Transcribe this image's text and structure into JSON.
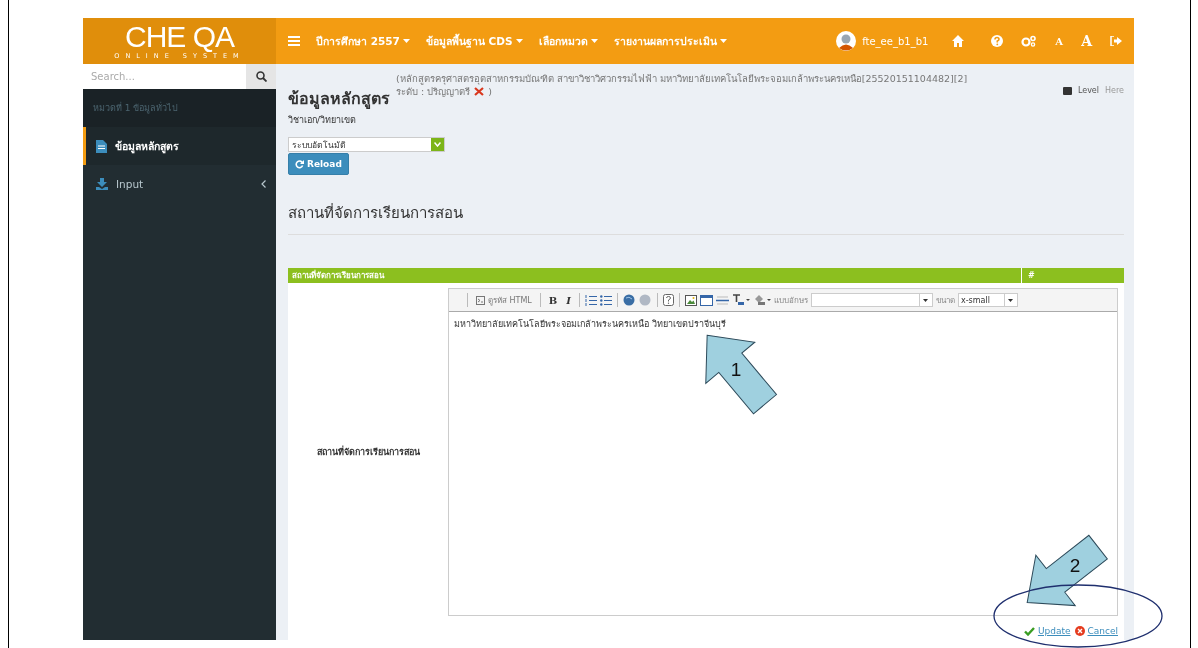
{
  "topbar": {
    "logo": {
      "title": "CHE QA",
      "subtitle": "ONLINE SYSTEM"
    },
    "nav": [
      {
        "label": "ปีการศึกษา 2557"
      },
      {
        "label": "ข้อมูลพื้นฐาน CDS"
      },
      {
        "label": "เลือกหมวด"
      },
      {
        "label": "รายงานผลการประเมิน"
      }
    ],
    "user": {
      "name": "fte_ee_b1_b1"
    },
    "font_buttons": [
      {
        "label": "A",
        "kind": "small"
      },
      {
        "label": "A",
        "kind": "large"
      }
    ]
  },
  "sidebar": {
    "search": {
      "placeholder": "Search..."
    },
    "section": "หมวดที่ 1 ข้อมูลทั่วไป",
    "items": [
      {
        "label": "ข้อมูลหลักสูตร",
        "kind": "document",
        "selected": true,
        "expandable": false
      },
      {
        "label": "Input",
        "kind": "download",
        "selected": false,
        "expandable": true
      }
    ]
  },
  "content": {
    "title": "ข้อมูลหลักสูตร",
    "program": "(หลักสูตรครุศาสตรอุตสาหกรรมบัณฑิต สาขาวิชาวิศวกรรมไฟฟ้า มหาวิทยาลัยเทคโนโลยีพระจอมเกล้าพระนครเหนือ[25520151104482][2]",
    "level_text": "ระดับ : ปริญญาตรี",
    "close_paren": ")",
    "breadcrumb": [
      "Level",
      "Here"
    ],
    "major_label": "วิชาเอก/วิทยาเขต",
    "major_select": {
      "value": "ระบบอัตโนมัติ"
    },
    "reload_button": "Reload",
    "section_title": "สถานที่จัดการเรียนการสอน",
    "table": {
      "columns": [
        "สถานที่จัดการเรียนการสอน",
        "#"
      ],
      "row": {
        "label": "สถานที่จัดการเรียนการสอน",
        "editor": {
          "source_button": "ดูรหัส HTML",
          "bold": "B",
          "italic": "I",
          "font_label": "แบบอักษร",
          "size_label": "ขนาด",
          "size_value": "x-small",
          "text": "มหาวิทยาลัยเทคโนโลยีพระจอมเกล้าพระนครเหนือ วิทยาเขตปราจีนบุรี"
        }
      }
    },
    "actions": [
      {
        "label": "Update",
        "kind": "update"
      },
      {
        "label": "Cancel",
        "kind": "cancel"
      }
    ]
  },
  "annotations": [
    {
      "number": "1",
      "kind": "up-left"
    },
    {
      "number": "2",
      "kind": "down-left"
    }
  ]
}
